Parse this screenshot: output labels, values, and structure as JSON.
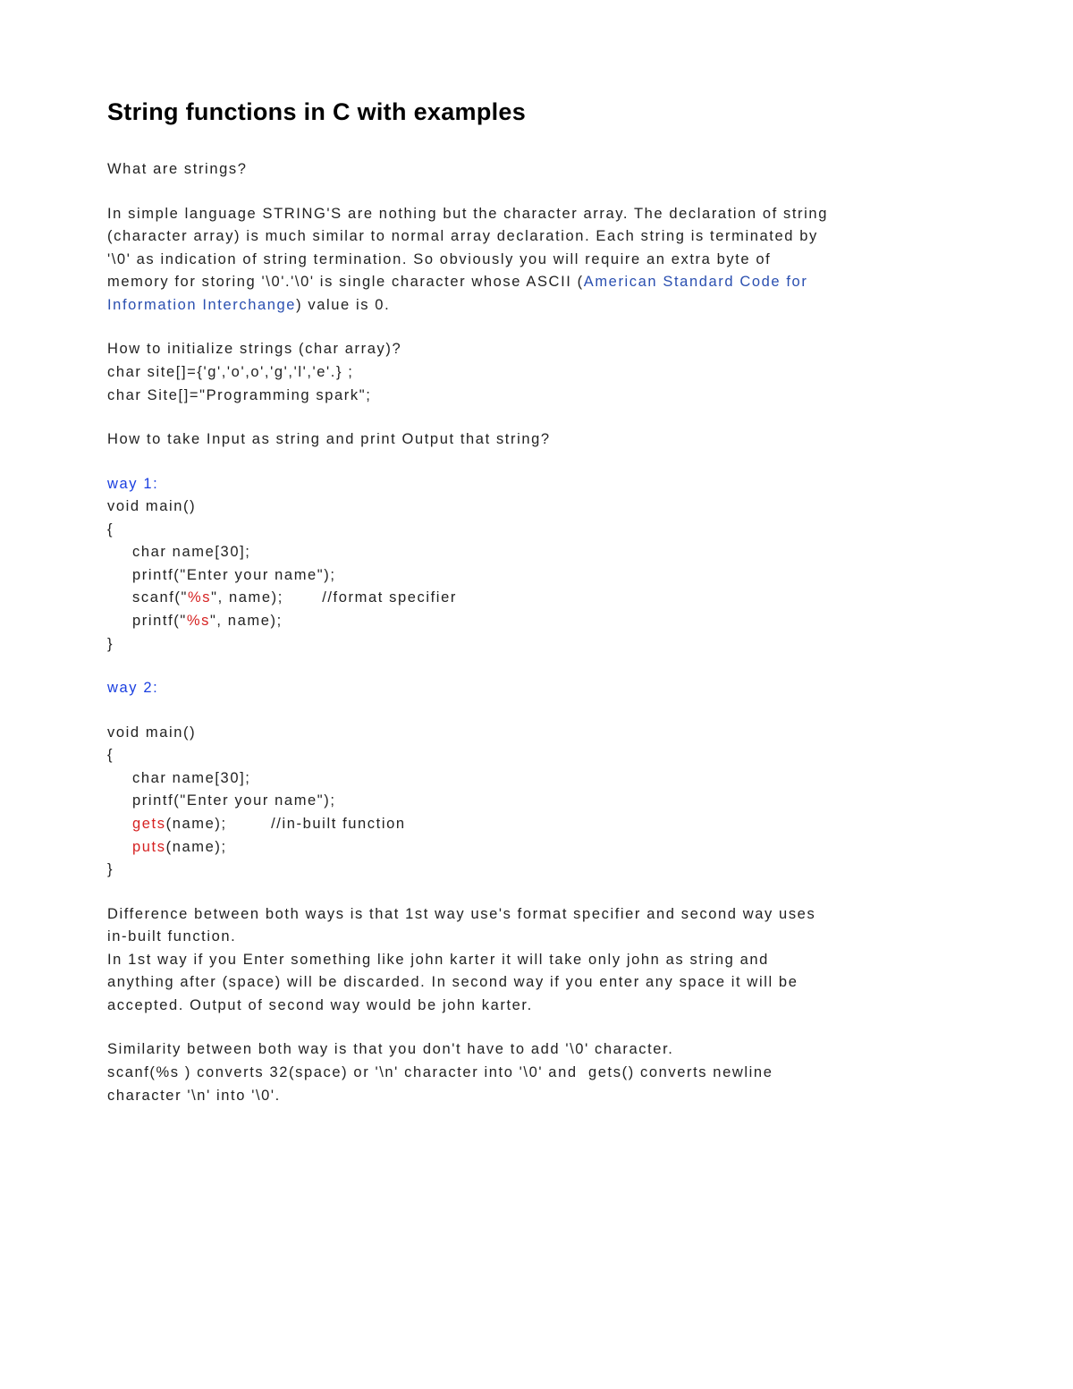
{
  "title": "String functions in C with examples",
  "p_whatare": "What are strings?",
  "intro": {
    "l1": "In simple language STRING'S are nothing but the character array. The declaration of string",
    "l2": "(character array) is much similar to normal array declaration. Each string is terminated by",
    "l3": "'\\0' as indication of string termination. So obviously you will require an extra byte of",
    "l4a": "memory for storing '\\0'.'\\0' is single character whose ASCII (",
    "l4link": "American Standard Code for",
    "l5link": "Information Interchange",
    "l5b": ") value is 0."
  },
  "init": {
    "h": "How to initialize strings (char array)?",
    "l1": "char site[]={'g','o',o','g','l','e'.} ;",
    "l2": "char Site[]=\"Programming spark\";"
  },
  "io_h": "How to take Input as string and print Output that string?",
  "way1": {
    "label": "way 1:",
    "l1": "void main()",
    "l2": "{",
    "l3": "char name[30];",
    "l4": "printf(\"Enter your name\");",
    "l5a": "scanf(\"",
    "l5fmt": "%s",
    "l5b": "\", name);       //format specifier",
    "l6a": "printf(\"",
    "l6fmt": "%s",
    "l6b": "\", name);",
    "l7": "}"
  },
  "way2": {
    "label": "way 2:",
    "l1": "void main()",
    "l2": "{",
    "l3": "char name[30];",
    "l4": "printf(\"Enter your name\");",
    "l5fn": "gets",
    "l5b": "(name);        //in-built function",
    "l6fn": "puts",
    "l6b": "(name);",
    "l7": "}"
  },
  "diff": {
    "l1": "Difference between both ways is that 1st way use's format specifier and second way uses",
    "l2": "in-built function.",
    "l3": "In 1st way if you Enter something like john karter it will take only john as string and",
    "l4": "anything after (space) will be discarded. In second way if you enter any space it will be",
    "l5": "accepted. Output of second way would be john karter."
  },
  "sim": {
    "l1": "Similarity between both way is that you don't have to add '\\0' character.",
    "l2": "scanf(%s ) converts 32(space) or '\\n' character into '\\0' and  gets() converts newline",
    "l3": "character '\\n' into '\\0'."
  }
}
